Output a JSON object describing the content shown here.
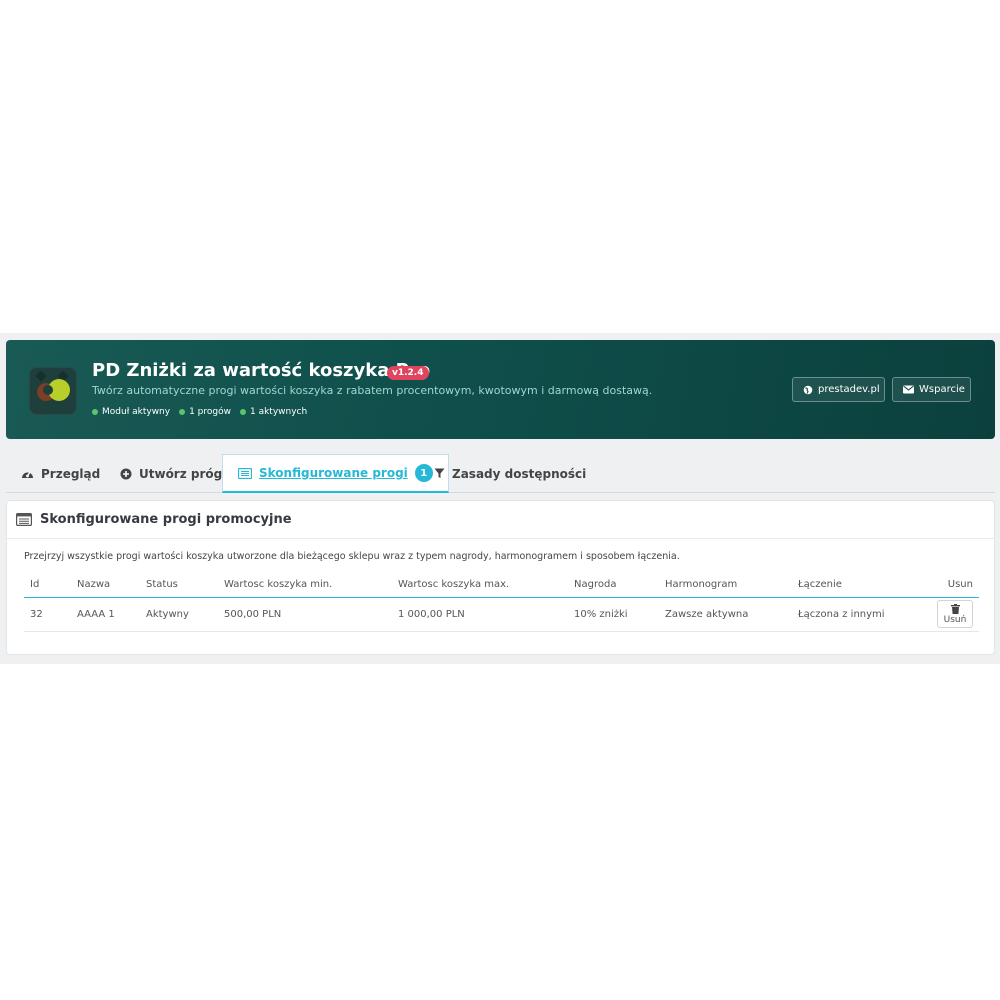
{
  "header": {
    "title": "PD Zniżki za wartość koszyka Pro",
    "version": "v1.2.4",
    "subtitle": "Twórz automatyczne progi wartości koszyka z rabatem procentowym, kwotowym i darmową dostawą.",
    "stats": [
      "Moduł aktywny",
      "1 progów",
      "1 aktywnych"
    ],
    "links": {
      "site": "prestadev.pl",
      "support": "Wsparcie"
    },
    "colors": {
      "gradient_start": "#1a5a55",
      "gradient_end": "#0b403d",
      "version_badge": "#e0455f",
      "status_dot": "#5cc46b"
    }
  },
  "tabs": [
    {
      "label": "Przegląd",
      "icon": "dashboard-icon"
    },
    {
      "label": "Utwórz próg",
      "icon": "plus-circle-icon"
    },
    {
      "label": "Skonfigurowane progi",
      "icon": "list-icon",
      "badge": "1",
      "active": true
    },
    {
      "label": "Zasady dostępności",
      "icon": "filter-icon"
    }
  ],
  "panel": {
    "title": "Skonfigurowane progi promocyjne",
    "description": "Przejrzyj wszystkie progi wartości koszyka utworzone dla bieżącego sklepu wraz z typem nagrody, harmonogramem i sposobem łączenia.",
    "columns": [
      "Id",
      "Nazwa",
      "Status",
      "Wartosc koszyka min.",
      "Wartosc koszyka max.",
      "Nagroda",
      "Harmonogram",
      "Łączenie",
      "Usun"
    ],
    "rows": [
      {
        "id": "32",
        "name": "AAAA 1",
        "status": "Aktywny",
        "min": "500,00 PLN",
        "max": "1 000,00 PLN",
        "reward": "10% zniżki",
        "schedule": "Zawsze aktywna",
        "combine": "Łączona z innymi",
        "delete": "Usuń"
      }
    ]
  },
  "accent_color": "#25b9d7"
}
